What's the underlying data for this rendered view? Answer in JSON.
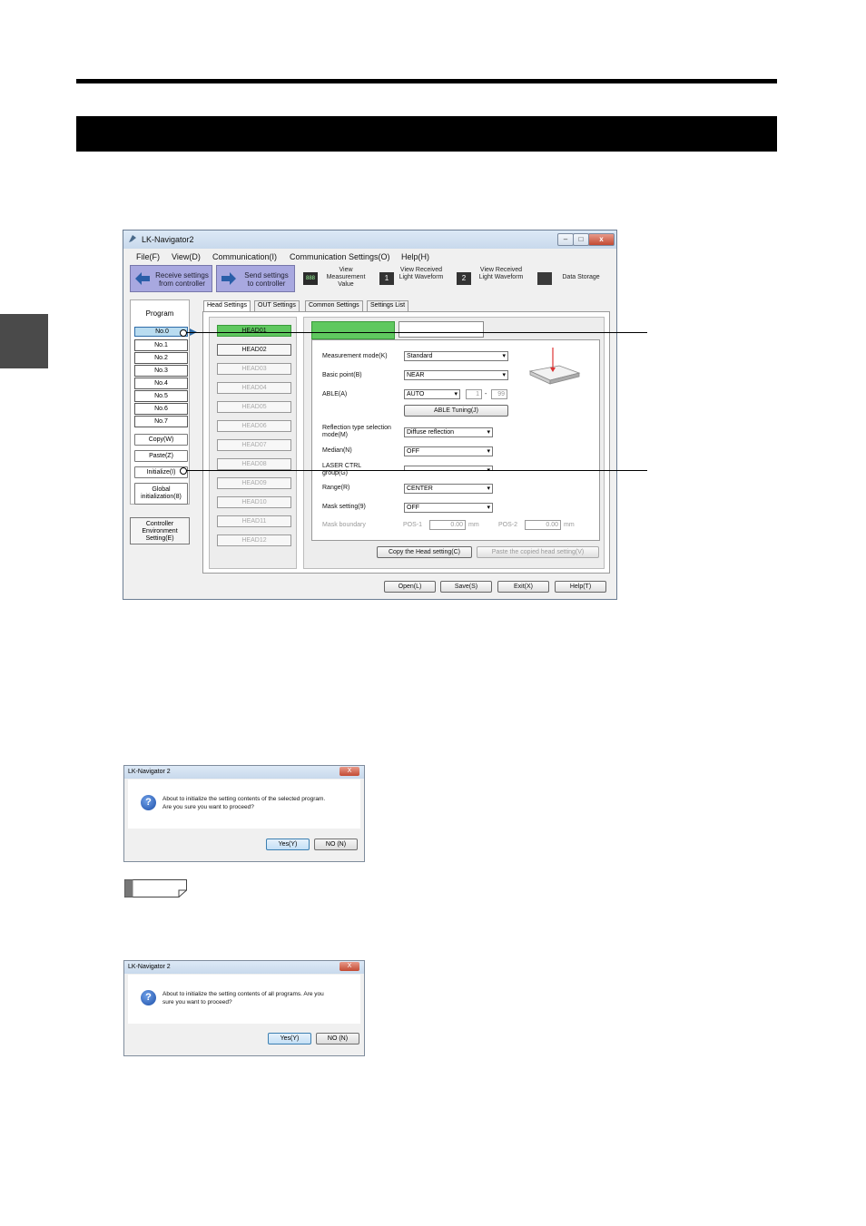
{
  "window": {
    "title": "LK-Navigator2",
    "controls": {
      "minimize": "–",
      "maximize": "□",
      "close": "x"
    }
  },
  "menu": [
    "File(F)",
    "View(D)",
    "Communication(I)",
    "Communication Settings(O)",
    "Help(H)"
  ],
  "toolbar": {
    "receive": "Receive settings from controller",
    "send": "Send settings to controller",
    "view_measurement": "View Measurement Value",
    "view_waveform1": "View Received Light Waveform",
    "view_waveform2": "View Received Light Waveform",
    "data_storage": "Data Storage",
    "icons": {
      "waveform1": "1",
      "waveform2": "2"
    }
  },
  "program": {
    "title": "Program",
    "items": [
      "No.0",
      "No.1",
      "No.2",
      "No.3",
      "No.4",
      "No.5",
      "No.6",
      "No.7"
    ],
    "selected": "No.0",
    "copy": "Copy(W)",
    "paste": "Paste(Z)",
    "initialize": "Initialize(I)",
    "global_init": "Global initialization(8)",
    "controller_env": "Controller Environment Setting(E)"
  },
  "tabs": [
    "Head Settings",
    "OUT Settings",
    "Common Settings",
    "Settings List"
  ],
  "heads": [
    "HEAD01",
    "HEAD02",
    "HEAD03",
    "HEAD04",
    "HEAD05",
    "HEAD06",
    "HEAD07",
    "HEAD08",
    "HEAD09",
    "HEAD10",
    "HEAD11",
    "HEAD12"
  ],
  "settings": {
    "measurement_mode_label": "Measurement mode(K)",
    "measurement_mode_value": "Standard",
    "basic_point_label": "Basic point(B)",
    "basic_point_value": "NEAR",
    "able_label": "ABLE(A)",
    "able_value": "AUTO",
    "able_min": "1",
    "able_dash": "-",
    "able_max": "99",
    "able_tuning": "ABLE Tuning(J)",
    "reflection_label": "Reflection type selection mode(M)",
    "reflection_value": "Diffuse reflection",
    "median_label": "Median(N)",
    "median_value": "OFF",
    "laser_label": "LASER CTRL group(G)",
    "range_label": "Range(R)",
    "range_value": "CENTER",
    "mask_label": "Mask setting(9)",
    "mask_value": "OFF",
    "mask_boundary_label": "Mask boundary",
    "pos1_label": "POS-1",
    "pos1_value": "0.00",
    "pos2_label": "POS-2",
    "pos2_value": "0.00",
    "unit": "mm",
    "copy_head": "Copy the Head setting(C)",
    "paste_head": "Paste the copied head setting(V)"
  },
  "bottom_buttons": [
    "Open(L)",
    "Save(S)",
    "Exit(X)",
    "Help(T)"
  ],
  "dialog1": {
    "title": "LK-Navigator 2",
    "close": "X",
    "icon": "?",
    "line1": "About to initialize the setting contents of the selected program.",
    "line2": "Are you sure you want to proceed?",
    "yes": "Yes(Y)",
    "no": "NO (N)"
  },
  "dialog2": {
    "title": "LK-Navigator 2",
    "close": "X",
    "icon": "?",
    "line1": "About to initialize the setting contents of all programs. Are you",
    "line2": "sure you want to proceed?",
    "yes": "Yes(Y)",
    "no": "NO (N)"
  }
}
